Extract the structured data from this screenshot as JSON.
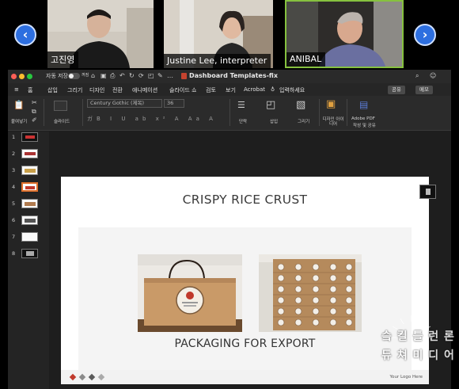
{
  "video_strip": {
    "participants": [
      {
        "name": "고진영",
        "active": false
      },
      {
        "name": "Justine Lee, interpreter",
        "active": false
      },
      {
        "name": "ANIBAL",
        "active": true
      }
    ],
    "prev_icon": "chevron-left-icon",
    "next_icon": "chevron-right-icon",
    "active_color": "#86c13f"
  },
  "window": {
    "autosave_label": "자동 저장",
    "autosave_state": "꺼짐",
    "doc_title": "Dashboard Templates-fix"
  },
  "menubar": {
    "items": [
      "홈",
      "삽입",
      "그리기",
      "디자인",
      "전환",
      "애니메이션",
      "슬라이드 쇼",
      "검토",
      "보기",
      "Acrobat"
    ],
    "tell_me": "입력하세요",
    "share_label": "공유",
    "comments_label": "메모"
  },
  "ribbon": {
    "paste_label": "붙여넣기",
    "slide_label": "슬라이드",
    "font_name": "Century Gothic (제목)",
    "font_size": "36",
    "paragraph_label": "단락",
    "shapes_label": "삽입",
    "drawing_label": "그리기",
    "designer_label": "디자인 아이디어",
    "acrobat_label_1": "Adobe PDF",
    "acrobat_label_2": "작성 및 공유"
  },
  "thumbnails": {
    "numbers": [
      "1",
      "2",
      "3",
      "4",
      "5",
      "6",
      "7",
      "8"
    ],
    "selected_index": 4
  },
  "slide": {
    "title": "CRISPY RICE CRUST",
    "caption": "PACKAGING FOR EXPORT",
    "footer_text": "Your Logo Here",
    "diamond_colors": [
      "#c0392b",
      "#8a8a8a",
      "#5a5a5a",
      "#aaaaaa"
    ]
  },
  "watermark": {
    "line1": "슼 킬 틀 런 론",
    "line2": "듀 쳐 미 디 어"
  }
}
